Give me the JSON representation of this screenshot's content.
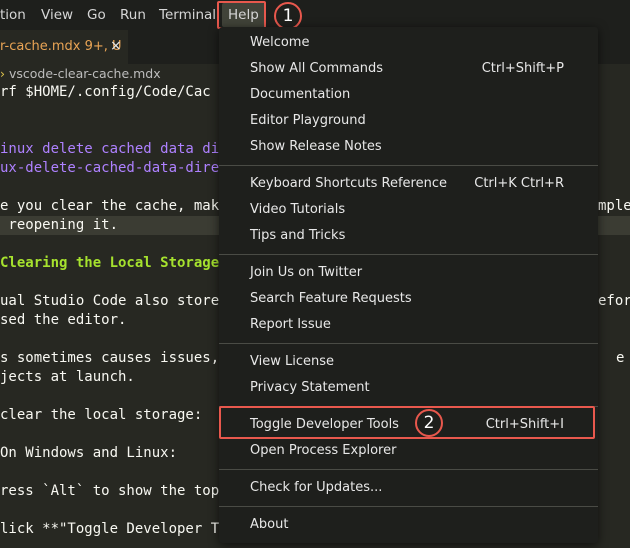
{
  "menubar": {
    "items": [
      "tion",
      "View",
      "Go",
      "Run",
      "Terminal",
      "Help"
    ]
  },
  "annotations": [
    "1",
    "2"
  ],
  "tab": {
    "name": "r-cache.mdx 9+, U",
    "close": "×"
  },
  "breadcrumb": {
    "file": "vscode-clear-cache.mdx"
  },
  "editor_lines": [
    "rf $HOME/.config/Code/Cac",
    "",
    "inux delete cached data di",
    "ux-delete-cached-data-dire",
    "",
    "e you clear the cache, mak",
    " reopening it.",
    "",
    "Clearing the Local Storage",
    "",
    "ual Studio Code also store",
    "sed the editor.",
    "",
    "s sometimes causes issues,",
    "jects at launch.",
    "",
    "clear the local storage:",
    "",
    "On Windows and Linux:",
    "",
    "ress `Alt` to show the top",
    "",
    "lick **\"Toggle Developer T"
  ],
  "editor_right": {
    "line5": "mplet",
    "line10": "efore",
    "line13": "e"
  },
  "help_menu": {
    "items": [
      {
        "label": "Welcome",
        "shortcut": ""
      },
      {
        "label": "Show All Commands",
        "shortcut": "Ctrl+Shift+P"
      },
      {
        "label": "Documentation",
        "shortcut": ""
      },
      {
        "label": "Editor Playground",
        "shortcut": ""
      },
      {
        "label": "Show Release Notes",
        "shortcut": ""
      },
      {
        "label": "Keyboard Shortcuts Reference",
        "shortcut": "Ctrl+K Ctrl+R"
      },
      {
        "label": "Video Tutorials",
        "shortcut": ""
      },
      {
        "label": "Tips and Tricks",
        "shortcut": ""
      },
      {
        "label": "Join Us on Twitter",
        "shortcut": ""
      },
      {
        "label": "Search Feature Requests",
        "shortcut": ""
      },
      {
        "label": "Report Issue",
        "shortcut": ""
      },
      {
        "label": "View License",
        "shortcut": ""
      },
      {
        "label": "Privacy Statement",
        "shortcut": ""
      },
      {
        "label": "Toggle Developer Tools",
        "shortcut": "Ctrl+Shift+I"
      },
      {
        "label": "Open Process Explorer",
        "shortcut": ""
      },
      {
        "label": "Check for Updates...",
        "shortcut": ""
      },
      {
        "label": "About",
        "shortcut": ""
      }
    ]
  },
  "colors": {
    "accent_annotation": "#e8584d",
    "menu_bg": "#1e1f1c",
    "editor_bg": "#272822"
  }
}
